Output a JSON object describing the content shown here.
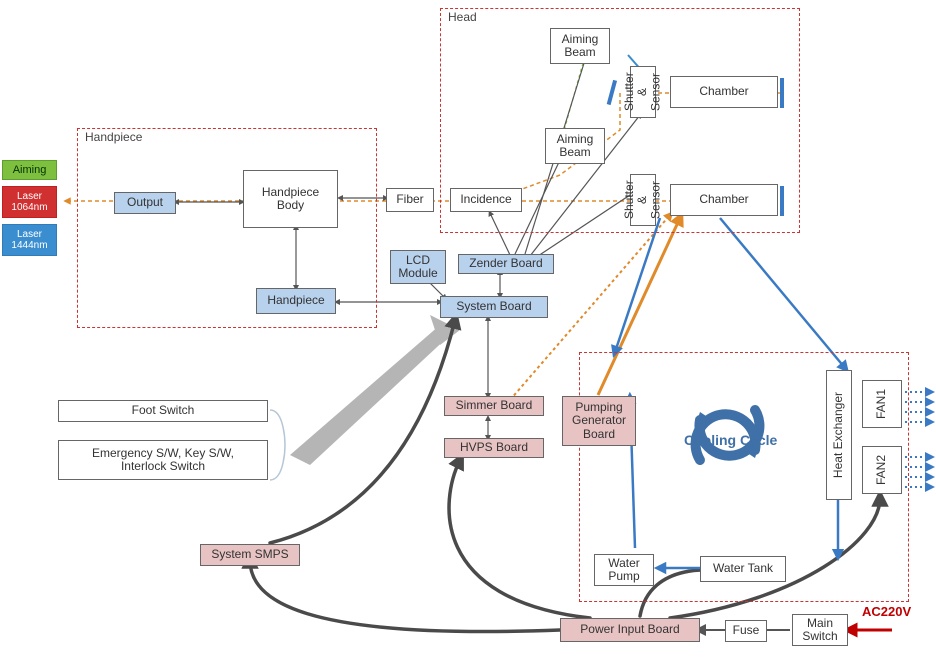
{
  "legend": {
    "aiming": "Aiming",
    "l1064": "Laser\n1064nm",
    "l1444": "Laser\n1444nm"
  },
  "groups": {
    "handpiece": "Handpiece",
    "head": "Head"
  },
  "blocks": {
    "output": "Output",
    "hp_body": "Handpiece\nBody",
    "hp2": "Handpiece",
    "fiber": "Fiber",
    "lcd": "LCD\nModule",
    "zender": "Zender Board",
    "sys": "System Board",
    "simmer": "Simmer Board",
    "hvps": "HVPS Board",
    "pumpgen": "Pumping\nGenerator\nBoard",
    "sysmps": "System SMPS",
    "pib": "Power Input Board",
    "fuse": "Fuse",
    "mainsw": "Main\nSwitch",
    "incidence": "Incidence",
    "aim1": "Aiming\nBeam",
    "aim2": "Aiming\nBeam",
    "shutter1": "Shutter\n& Sensor",
    "shutter2": "Shutter\n& Sensor",
    "chamber1": "Chamber",
    "chamber2": "Chamber",
    "wpump": "Water\nPump",
    "wtank": "Water Tank",
    "heatx": "Heat Exchanger",
    "fan1": "FAN1",
    "fan2": "FAN2"
  },
  "text": {
    "foot": "Foot Switch",
    "estop": "Emergency S/W, Key S/W,\nInterlock Switch",
    "cooling": "Cooling Cycle",
    "ac": "AC220V"
  }
}
